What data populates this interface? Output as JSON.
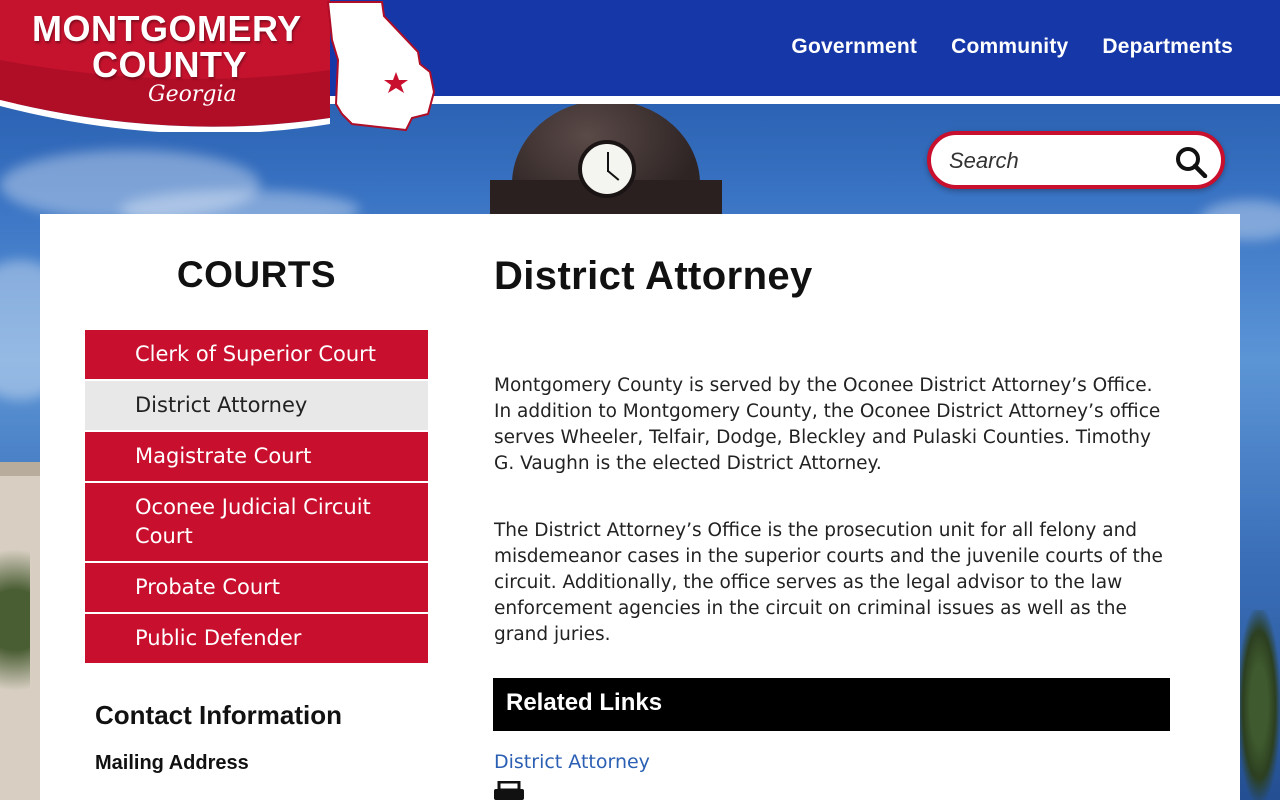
{
  "site": {
    "logo_line1": "MONTGOMERY",
    "logo_line2": "COUNTY",
    "logo_line3": "Georgia"
  },
  "nav": {
    "items": [
      "Government",
      "Community",
      "Departments"
    ]
  },
  "search": {
    "placeholder": "Search"
  },
  "sidebar": {
    "title": "COURTS",
    "items": [
      {
        "label": "Clerk of Superior Court"
      },
      {
        "label": "District Attorney"
      },
      {
        "label": "Magistrate Court"
      },
      {
        "label": "Oconee Judicial Circuit Court"
      },
      {
        "label": "Probate Court"
      },
      {
        "label": "Public Defender"
      }
    ],
    "active_index": 1,
    "contact_heading": "Contact Information",
    "mailing_heading": "Mailing Address"
  },
  "main": {
    "title": "District Attorney",
    "paragraph1": "Montgomery County is served by the Oconee District Attorney’s Office.  In addition to Montgomery County, the Oconee District Attorney’s office serves Wheeler, Telfair, Dodge, Bleckley and Pulaski Counties.  Timothy G. Vaughn is the elected District Attorney.",
    "paragraph2": "The District Attorney’s Office is the prosecution unit for all felony and misdemeanor cases in the superior courts and the juvenile courts of the circuit. Additionally, the office serves as the legal advisor to the law enforcement agencies in the circuit on criminal issues as well as the grand juries.",
    "related_heading": "Related Links",
    "related_links": [
      "District Attorney"
    ]
  },
  "colors": {
    "brand_red": "#c8102e",
    "header_blue": "#1637a8",
    "link_blue": "#2b5fb3"
  }
}
